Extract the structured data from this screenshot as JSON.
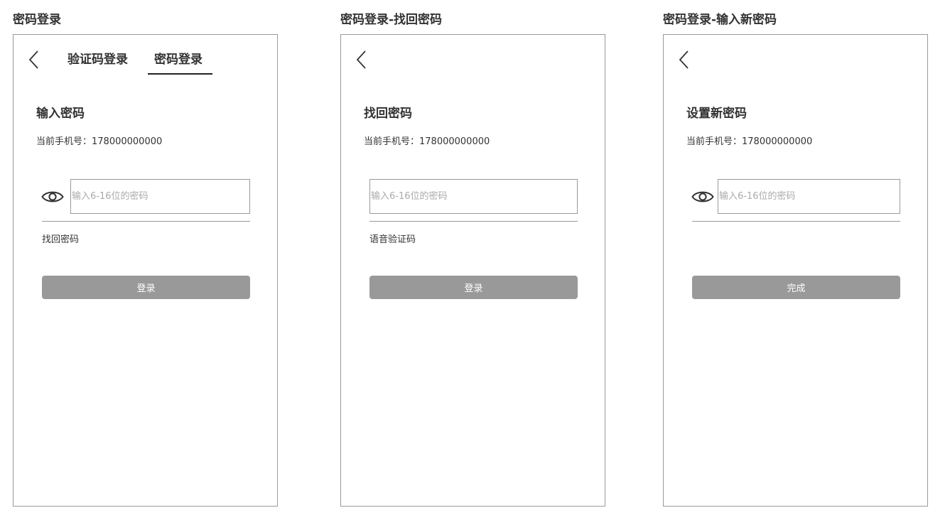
{
  "screens": [
    {
      "title": "密码登录",
      "tabs": [
        {
          "label": "验证码登录",
          "active": false
        },
        {
          "label": "密码登录",
          "active": true
        }
      ],
      "heading": "输入密码",
      "phone_label": "当前手机号：178000000000",
      "password_placeholder": "输入6-16位的密码",
      "password_value": "",
      "link_label": "找回密码",
      "button_label": "登录",
      "back_icon": "chevron-left-icon",
      "eye_icon": "eye-icon"
    },
    {
      "title": "密码登录-找回密码",
      "heading": "找回密码",
      "phone_label": "当前手机号：178000000000",
      "password_placeholder": "输入6-16位的密码",
      "password_value": "",
      "link_label": "语音验证码",
      "button_label": "登录",
      "back_icon": "chevron-left-icon"
    },
    {
      "title": "密码登录-输入新密码",
      "heading": "设置新密码",
      "phone_label": "当前手机号：178000000000",
      "password_placeholder": "输入6-16位的密码",
      "password_value": "",
      "button_label": "完成",
      "back_icon": "chevron-left-icon",
      "eye_icon": "eye-icon"
    }
  ],
  "colors": {
    "text": "#333333",
    "border": "#999999",
    "button_bg": "#999999",
    "button_text": "#ffffff",
    "placeholder": "#aaaaaa",
    "tab_underline": "#222222"
  }
}
